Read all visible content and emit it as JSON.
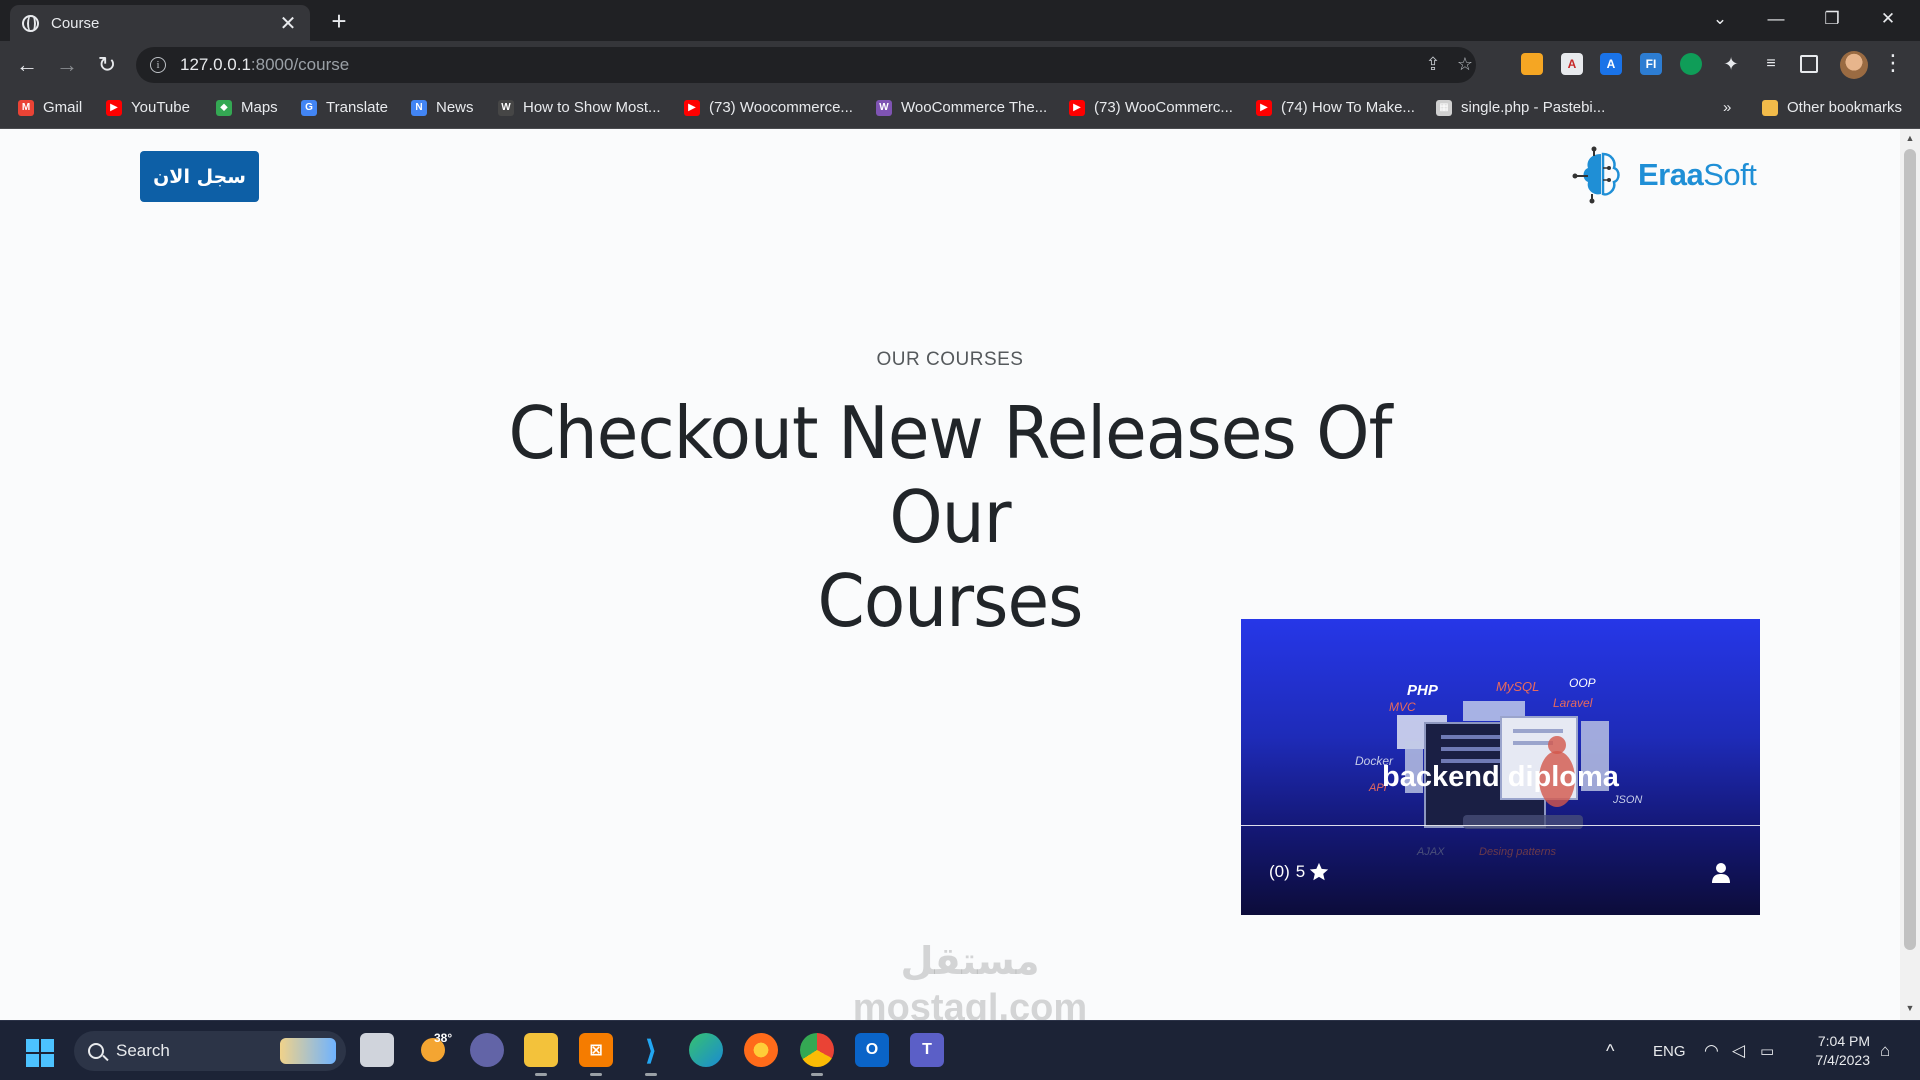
{
  "browser": {
    "tab_title": "Course",
    "tab_close": "✕",
    "new_tab": "+",
    "url_host": "127.0.0.1",
    "url_path": ":8000/course",
    "window_controls": {
      "collapse": "⌄",
      "minimize": "—",
      "restore": "❐",
      "close": "✕"
    },
    "nav": {
      "back": "←",
      "forward": "→",
      "reload": "↻"
    },
    "bookmarks": [
      {
        "label": "Gmail",
        "icon": "gmail-icon",
        "color": "#ea4335"
      },
      {
        "label": "YouTube",
        "icon": "youtube-icon",
        "color": "#ff0000"
      },
      {
        "label": "Maps",
        "icon": "maps-icon",
        "color": "#34a853"
      },
      {
        "label": "Translate",
        "icon": "translate-icon",
        "color": "#4285f4"
      },
      {
        "label": "News",
        "icon": "news-icon",
        "color": "#4285f4"
      },
      {
        "label": "How to Show Most...",
        "icon": "wordpress-icon",
        "color": "#464646"
      },
      {
        "label": "(73) Woocommerce...",
        "icon": "youtube-icon",
        "color": "#ff0000"
      },
      {
        "label": "WooCommerce The...",
        "icon": "woocommerce-icon",
        "color": "#7f54b3"
      },
      {
        "label": "(73) WooCommerc...",
        "icon": "youtube-icon",
        "color": "#ff0000"
      },
      {
        "label": "(74) How To Make...",
        "icon": "youtube-icon",
        "color": "#ff0000"
      },
      {
        "label": "single.php - Pastebi...",
        "icon": "pastebin-icon",
        "color": "#d0d0d0"
      }
    ],
    "bookmarks_overflow": "»",
    "other_bookmarks": "Other bookmarks"
  },
  "page": {
    "register_button": "سجل الان",
    "logo": {
      "brand_bold": "Eraa",
      "brand_regular": "Soft",
      "color": "#1f8fd6"
    },
    "eyebrow": "OUR COURSES",
    "headline_line1": "Checkout New Releases Of Our",
    "headline_line2": "Courses",
    "courses": [
      {
        "title": "backend diploma",
        "rating_count": "(0)",
        "rating_value": "5",
        "graphic_labels": [
          "PHP",
          "MySQL",
          "OOP",
          "MVC",
          "Laravel",
          "Docker",
          "API",
          "JSON",
          "AJAX",
          "Desing patterns"
        ]
      }
    ],
    "watermark_arabic": "مستقل",
    "watermark_latin": "mostaql.com"
  },
  "taskbar": {
    "search_label": "Search",
    "weather": "38°",
    "language": "ENG",
    "time": "7:04 PM",
    "date": "7/4/2023",
    "tray_chevron": "^"
  }
}
